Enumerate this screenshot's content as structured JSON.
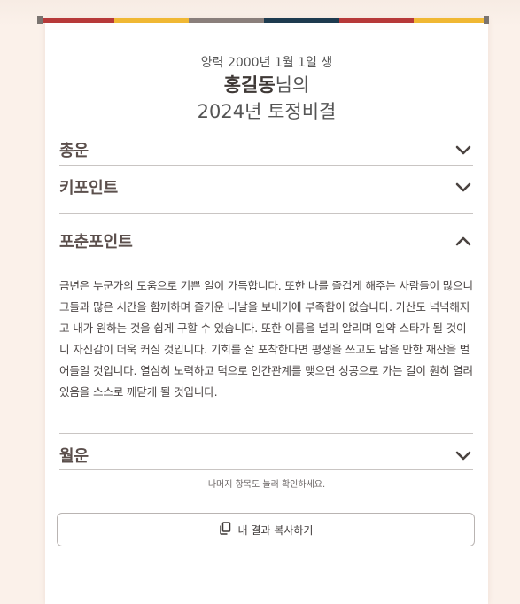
{
  "header": {
    "birth_line": "양력 2000년 1월 1일 생",
    "name": "홍길동",
    "name_suffix": "님의",
    "title_line2": "2024년 토정비결"
  },
  "sections": [
    {
      "label": "총운",
      "expanded": false
    },
    {
      "label": "키포인트",
      "expanded": false
    },
    {
      "label": "포춘포인트",
      "expanded": true,
      "body": "금년은 누군가의 도움으로 기쁜 일이 가득합니다. 또한 나를 즐겁게 해주는 사람들이 많으니 그들과 많은 시간을 함께하며 즐거운 나날을 보내기에 부족함이 없습니다. 가산도 넉넉해지고 내가 원하는 것을 쉽게 구할 수 있습니다. 또한 이름을 널리 알리며 일약 스타가 될 것이니 자신감이 더욱 커질 것입니다. 기회를 잘 포착한다면 평생을 쓰고도 남을 만한 재산을 벌어들일 것입니다. 열심히 노력하고 덕으로 인간관계를 맺으면 성공으로 가는 길이 훤히 열려 있음을 스스로 깨닫게 될 것입니다."
    },
    {
      "label": "월운",
      "expanded": false
    }
  ],
  "hint_text": "나머지 항목도 눌러 확인하세요.",
  "copy_button_label": "내 결과 복사하기",
  "icons": {
    "collapsed": "chevron-down-icon",
    "expanded": "chevron-up-icon",
    "copy": "copy-icon"
  },
  "colors": {
    "stripe": [
      "#b73a3a",
      "#f0b834",
      "#8a7f7b",
      "#1e3b4f",
      "#b73a3a",
      "#f0b834"
    ],
    "background": "#fbf1ea"
  }
}
